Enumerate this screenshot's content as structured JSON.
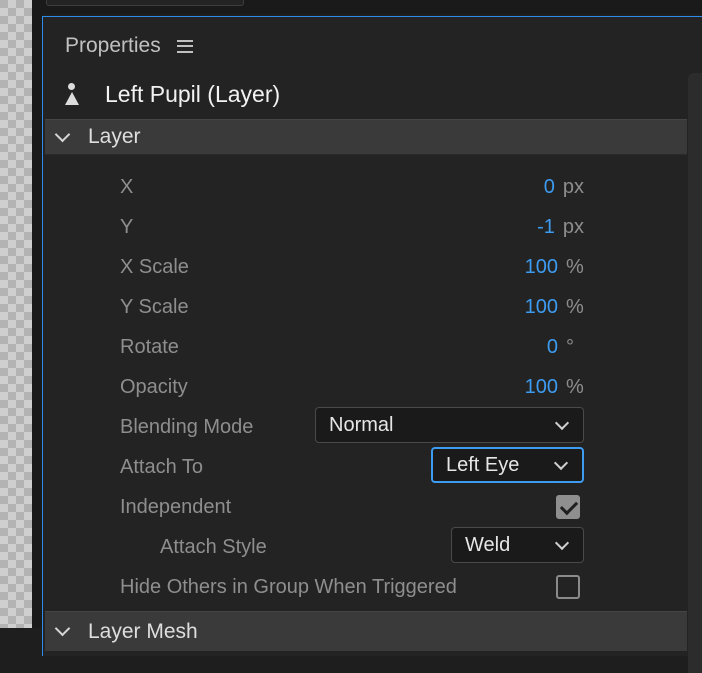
{
  "panel": {
    "title": "Properties"
  },
  "layer": {
    "name": "Left Pupil (Layer)"
  },
  "sections": {
    "layer": "Layer",
    "layer_mesh": "Layer Mesh"
  },
  "props": {
    "x": {
      "label": "X",
      "value": "0",
      "unit": "px"
    },
    "y": {
      "label": "Y",
      "value": "-1",
      "unit": "px"
    },
    "x_scale": {
      "label": "X Scale",
      "value": "100",
      "unit": "%"
    },
    "y_scale": {
      "label": "Y Scale",
      "value": "100",
      "unit": "%"
    },
    "rotate": {
      "label": "Rotate",
      "value": "0",
      "unit": "°"
    },
    "opacity": {
      "label": "Opacity",
      "value": "100",
      "unit": "%"
    },
    "blending_mode": {
      "label": "Blending Mode",
      "selected": "Normal"
    },
    "attach_to": {
      "label": "Attach To",
      "selected": "Left Eye"
    },
    "independent": {
      "label": "Independent",
      "checked": true
    },
    "attach_style": {
      "label": "Attach Style",
      "selected": "Weld"
    },
    "hide_others": {
      "label": "Hide Others in Group When Triggered",
      "checked": false
    }
  },
  "colors": {
    "accent": "#3d9bf0",
    "panel_bg": "#232323",
    "section_bg": "#3a3a3a",
    "focus_border": "#2d8ceb"
  },
  "icons": {
    "layer": "puppet-layer-icon",
    "menu": "hamburger-menu-icon"
  }
}
